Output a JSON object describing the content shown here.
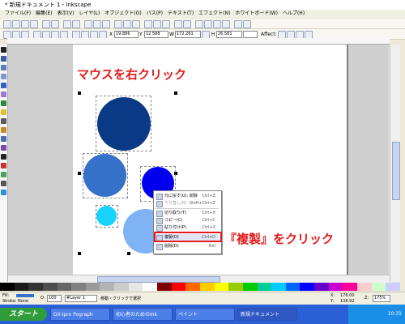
{
  "window": {
    "title": "* 新規ドキュメント 1 - Inkscape"
  },
  "menubar": [
    "ファイル(F)",
    "編集(E)",
    "表示(V)",
    "レイヤ(L)",
    "オブジェクト(O)",
    "パス(P)",
    "テキスト(T)",
    "エフェクト(N)",
    "ホワイトボード(W)",
    "ヘルプ(H)"
  ],
  "toolbar": {
    "x_value": "19.886",
    "y_value": "12.588",
    "w_value": "172.261",
    "h_value": "26.581",
    "affect_label": "Affect:"
  },
  "annotations": {
    "right_click": "マウスを右クリック",
    "duplicate_click": "『複製』をクリック"
  },
  "context_menu": [
    {
      "label": "元に戻す(U): 削除",
      "shortcut": "Ctrl+Z",
      "disabled": false
    },
    {
      "label": "やり直し(R)",
      "shortcut": "Shift+Ctrl+Z",
      "disabled": true
    },
    {
      "label": "切り取り(T)",
      "shortcut": "Ctrl+X",
      "disabled": false
    },
    {
      "label": "コピー(C)",
      "shortcut": "Ctrl+C",
      "disabled": false
    },
    {
      "label": "貼り付け(P)",
      "shortcut": "Ctrl+V",
      "disabled": false
    },
    {
      "label": "複製(D)",
      "shortcut": "Ctrl+D",
      "disabled": false,
      "highlighted": true
    },
    {
      "label": "削除(D)",
      "shortcut": "Del",
      "disabled": false
    }
  ],
  "status": {
    "fill_label": "Fill:",
    "stroke_label": "Stroke:",
    "stroke_value": "None",
    "opacity": "100",
    "layer": "#Layer 1",
    "message": "移動・クリックで選択",
    "x_coord": "176.00",
    "y_coord": "138.92",
    "zoom": "175%"
  },
  "taskbar": {
    "start_label": "スタート",
    "tasks": [
      "DX-Ipro Pograph",
      "初心者のためのInk",
      "ペイント",
      "新規ドキュメント"
    ],
    "clock": "10:31"
  },
  "colors": {
    "circle_dark": "#0a3a86",
    "circle_mid": "#3570c9",
    "circle_bright": "#0000ee",
    "circle_cyan": "#19d3ff",
    "circle_light": "#7fb3f5",
    "accent_red": "#e31b1b"
  }
}
